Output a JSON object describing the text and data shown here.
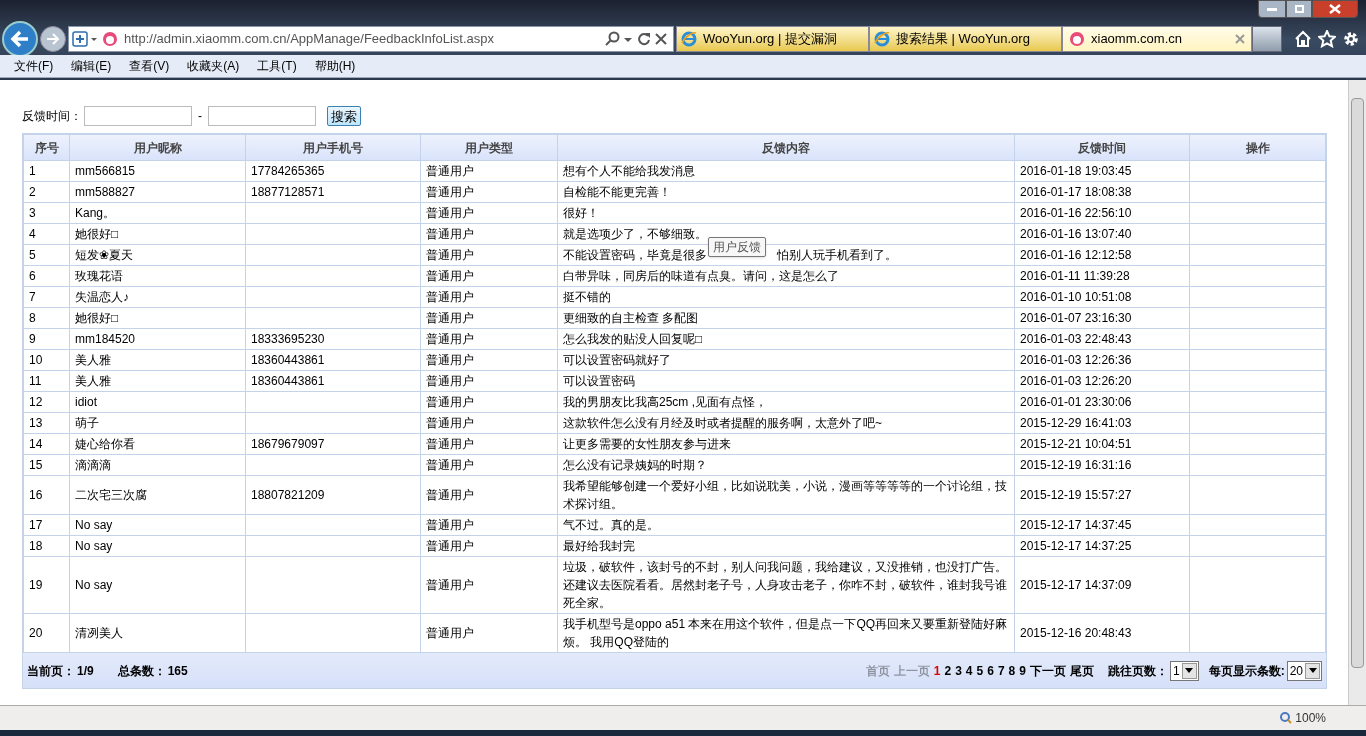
{
  "browser": {
    "address": "http://admin.xiaomm.com.cn/AppManage/FeedbackInfoList.aspx",
    "tabs": [
      {
        "title": "WooYun.org | 提交漏洞",
        "selected": false
      },
      {
        "title": "搜索结果 | WooYun.org",
        "selected": false
      },
      {
        "title": "xiaomm.com.cn",
        "selected": true
      }
    ],
    "menu": [
      "文件(F)",
      "编辑(E)",
      "查看(V)",
      "收藏夹(A)",
      "工具(T)",
      "帮助(H)"
    ],
    "zoom": "100%"
  },
  "filter": {
    "label": "反馈时间：",
    "separator": "-",
    "button": "搜索"
  },
  "table": {
    "columns": [
      "序号",
      "用户昵称",
      "用户手机号",
      "用户类型",
      "反馈内容",
      "反馈时间",
      "操作"
    ],
    "rows": [
      {
        "id": "1",
        "nickname": "mm566815",
        "phone": "17784265365",
        "type": "普通用户",
        "content": "想有个人不能给我发消息",
        "time": "2016-01-18 19:03:45"
      },
      {
        "id": "2",
        "nickname": "mm588827",
        "phone": "18877128571",
        "type": "普通用户",
        "content": "自检能不能更完善！",
        "time": "2016-01-17 18:08:38"
      },
      {
        "id": "3",
        "nickname": "Kang。",
        "type": "普通用户",
        "content": "很好！",
        "time": "2016-01-16 22:56:10"
      },
      {
        "id": "4",
        "nickname": "她很好□",
        "type": "普通用户",
        "content": "就是选项少了，不够细致。",
        "time": "2016-01-16 13:07:40"
      },
      {
        "id": "5",
        "nickname": "短发❀夏天",
        "type": "普通用户",
        "content": "不能设置密码，毕竟是很多",
        "content_tail": "怕别人玩手机看到了。",
        "time": "2016-01-16 12:12:58"
      },
      {
        "id": "6",
        "nickname": "玫瑰花语",
        "type": "普通用户",
        "content": "白带异味，同房后的味道有点臭。请问，这是怎么了",
        "time": "2016-01-11 11:39:28"
      },
      {
        "id": "7",
        "nickname": "失温恋人♪",
        "type": "普通用户",
        "content": "挺不错的",
        "time": "2016-01-10 10:51:08"
      },
      {
        "id": "8",
        "nickname": "她很好□",
        "type": "普通用户",
        "content": "更细致的自主检查 多配图",
        "time": "2016-01-07 23:16:30"
      },
      {
        "id": "9",
        "nickname": "mm184520",
        "phone": "18333695230",
        "type": "普通用户",
        "content": "怎么我发的贴没人回复呢□",
        "time": "2016-01-03 22:48:43"
      },
      {
        "id": "10",
        "nickname": "美人雅",
        "phone": "18360443861",
        "type": "普通用户",
        "content": "可以设置密码就好了",
        "time": "2016-01-03 12:26:36"
      },
      {
        "id": "11",
        "nickname": "美人雅",
        "phone": "18360443861",
        "type": "普通用户",
        "content": "可以设置密码",
        "time": "2016-01-03 12:26:20"
      },
      {
        "id": "12",
        "nickname": "idiot",
        "type": "普通用户",
        "content": "我的男朋友比我高25cm ,见面有点怪，",
        "time": "2016-01-01 23:30:06"
      },
      {
        "id": "13",
        "nickname": "萌子",
        "type": "普通用户",
        "content": "这款软件怎么没有月经及时或者提醒的服务啊，太意外了吧~",
        "time": "2015-12-29 16:41:03"
      },
      {
        "id": "14",
        "nickname": "婕心给你看",
        "phone": "18679679097",
        "type": "普通用户",
        "content": "让更多需要的女性朋友参与进来",
        "time": "2015-12-21 10:04:51"
      },
      {
        "id": "15",
        "nickname": "滴滴滴",
        "type": "普通用户",
        "content": "怎么没有记录姨妈的时期？",
        "time": "2015-12-19 16:31:16"
      },
      {
        "id": "16",
        "nickname": "二次宅三次腐",
        "phone": "18807821209",
        "type": "普通用户",
        "content": "我希望能够创建一个爱好小组，比如说耽美，小说，漫画等等等等的一个讨论组，技术探讨组。",
        "time": "2015-12-19 15:57:27"
      },
      {
        "id": "17",
        "nickname": "No say",
        "type": "普通用户",
        "content": "气不过。真的是。",
        "time": "2015-12-17 14:37:45"
      },
      {
        "id": "18",
        "nickname": "No say",
        "type": "普通用户",
        "content": "最好给我封完",
        "time": "2015-12-17 14:37:25"
      },
      {
        "id": "19",
        "nickname": "No say",
        "type": "普通用户",
        "content": "垃圾，破软件，该封号的不封，别人问我问题，我给建议，又没推销，也没打广告。还建议去医院看看。居然封老子号，人身攻击老子，你咋不封，破软件，谁封我号谁死全家。",
        "time": "2015-12-17 14:37:09"
      },
      {
        "id": "20",
        "nickname": "清冽美人",
        "type": "普通用户",
        "content": "我手机型号是oppo a51 本来在用这个软件，但是点一下QQ再回来又要重新登陆好麻烦。 我用QQ登陆的",
        "time": "2015-12-16 20:48:43"
      }
    ]
  },
  "tooltip": "用户反馈",
  "pager": {
    "current_label": "当前页：",
    "current": "1/9",
    "total_label": "总条数：",
    "total": "165",
    "links": [
      {
        "label": "首页",
        "disabled": true,
        "selected": false
      },
      {
        "label": "上一页",
        "disabled": true,
        "selected": false
      },
      {
        "label": "1",
        "disabled": false,
        "selected": true
      },
      {
        "label": "2",
        "disabled": false,
        "selected": false
      },
      {
        "label": "3",
        "disabled": false,
        "selected": false
      },
      {
        "label": "4",
        "disabled": false,
        "selected": false
      },
      {
        "label": "5",
        "disabled": false,
        "selected": false
      },
      {
        "label": "6",
        "disabled": false,
        "selected": false
      },
      {
        "label": "7",
        "disabled": false,
        "selected": false
      },
      {
        "label": "8",
        "disabled": false,
        "selected": false
      },
      {
        "label": "9",
        "disabled": false,
        "selected": false
      },
      {
        "label": "下一页",
        "disabled": false,
        "selected": false
      },
      {
        "label": "尾页",
        "disabled": false,
        "selected": false
      }
    ],
    "jump_label": "跳往页数：",
    "jump_value": "1",
    "size_label": "每页显示条数:",
    "size_value": "20"
  }
}
